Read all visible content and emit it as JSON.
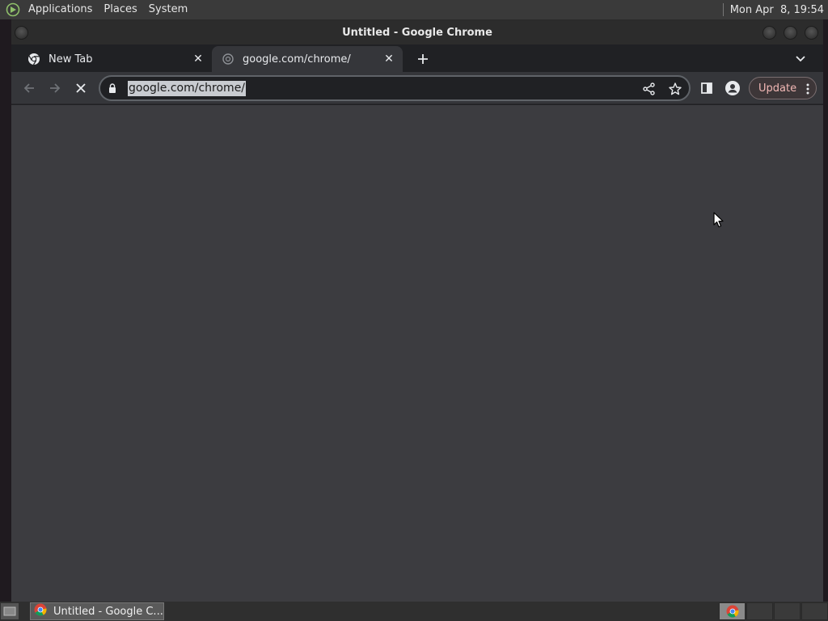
{
  "top_panel": {
    "menus": [
      "Applications",
      "Places",
      "System"
    ],
    "clock": "Mon Apr  8, 19:54"
  },
  "window": {
    "title": "Untitled - Google Chrome"
  },
  "tabs": [
    {
      "title": "New Tab",
      "icon": "chrome-icon",
      "active": false
    },
    {
      "title": "google.com/chrome/",
      "icon": "loading-globe-icon",
      "active": true
    }
  ],
  "toolbar": {
    "url": "google.com/chrome/",
    "update_label": "Update"
  },
  "taskbar": {
    "task_title": "Untitled - Google C..."
  },
  "colors": {
    "content_bg": "#3c3c40",
    "toolbar_bg": "#35363a",
    "update_text": "#f2b8b5"
  }
}
